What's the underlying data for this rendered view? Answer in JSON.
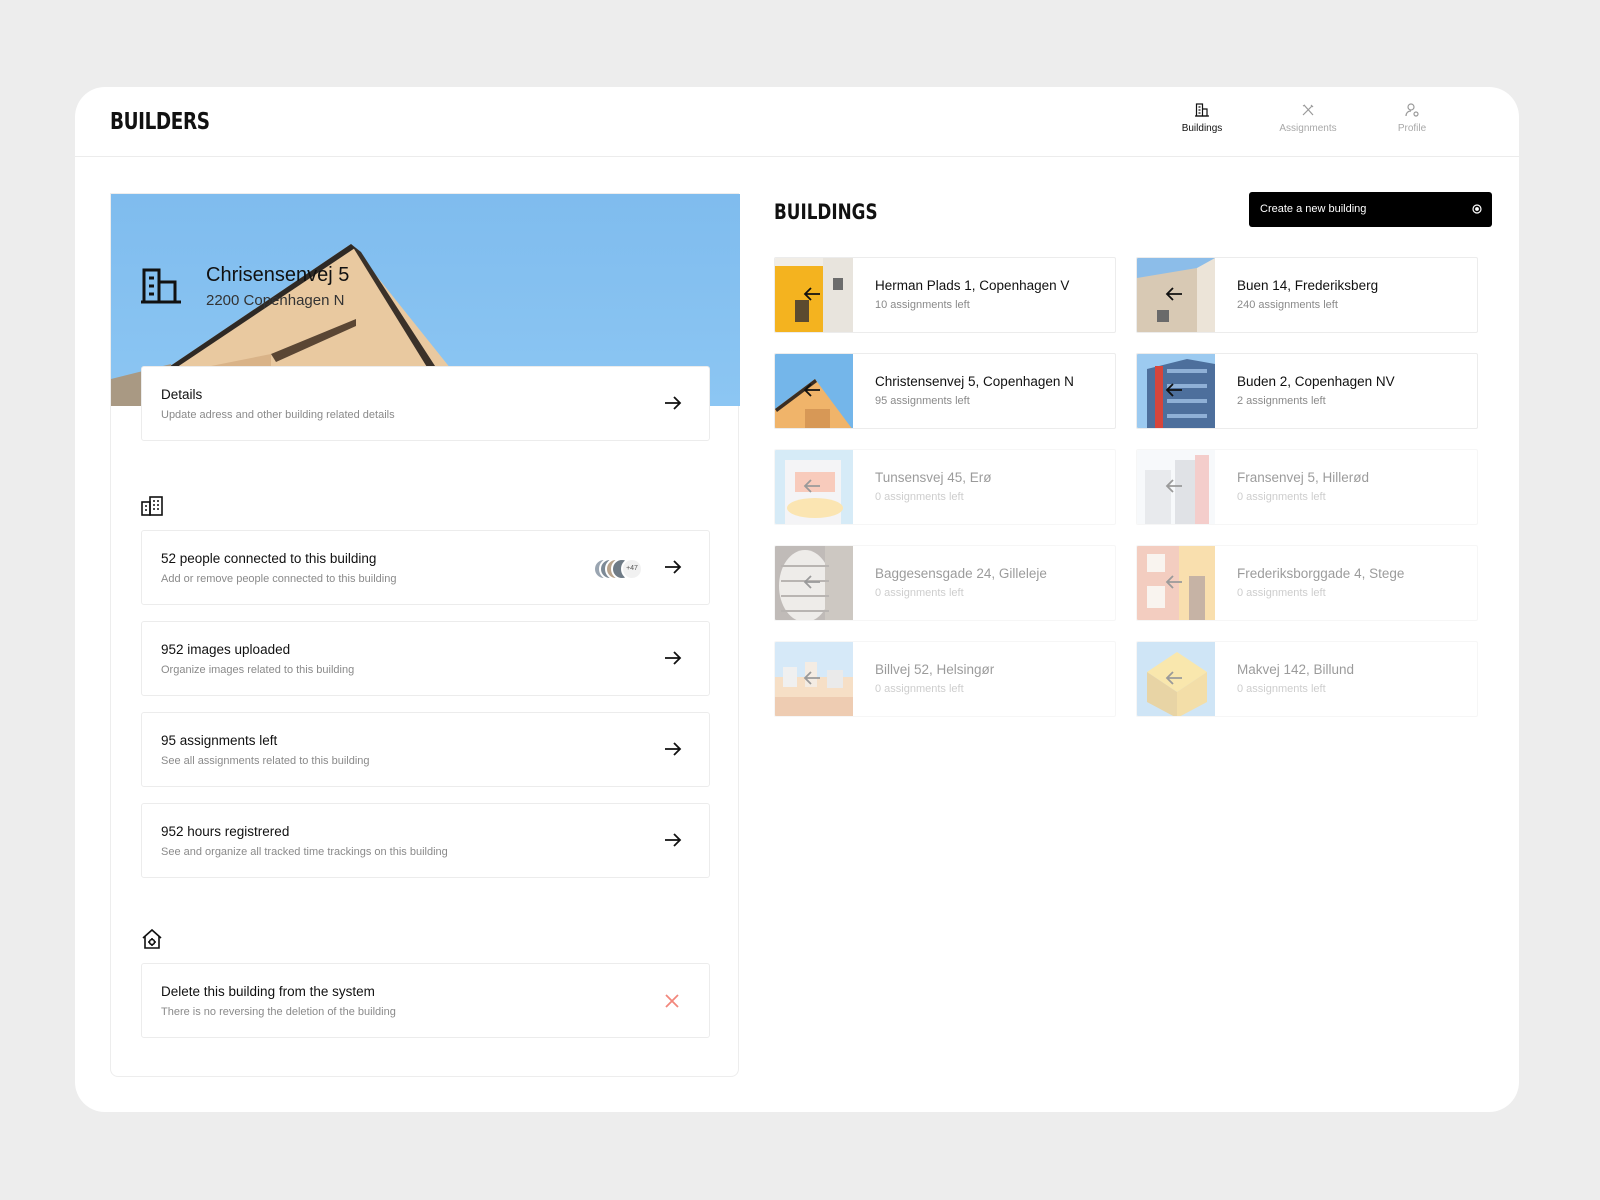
{
  "app": {
    "logo": "BUILDERS"
  },
  "nav": [
    {
      "label": "Buildings",
      "icon": "building-icon",
      "active": true
    },
    {
      "label": "Assignments",
      "icon": "tools-icon",
      "active": false
    },
    {
      "label": "Profile",
      "icon": "profile-icon",
      "active": false
    }
  ],
  "detail": {
    "title": "Chrisensenvej 5",
    "subtitle": "2200 Copenhagen N",
    "details_card": {
      "title": "Details",
      "subtitle": "Update adress and other building related details"
    },
    "people_card": {
      "title": "52 people connected to this building",
      "subtitle": "Add or remove people connected to this building",
      "more_count": "+47"
    },
    "images_card": {
      "title": "952 images uploaded",
      "subtitle": "Organize images related to this building"
    },
    "assignments_card": {
      "title": "95 assignments left",
      "subtitle": "See all assignments related to this building"
    },
    "hours_card": {
      "title": "952 hours registrered",
      "subtitle": "See and organize all tracked time trackings on this building"
    },
    "delete_card": {
      "title": "Delete this building from the system",
      "subtitle": "There is no reversing the deletion of the building"
    }
  },
  "buildings": {
    "title": "BUILDINGS",
    "create_label": "Create a new building",
    "items": [
      {
        "name": "Herman Plads 1, Copenhagen V",
        "assignments": "10 assignments left",
        "faded": false,
        "thumb": "yellow-building"
      },
      {
        "name": "Buen 14, Frederiksberg",
        "assignments": "240 assignments left",
        "faded": false,
        "thumb": "beige-wall"
      },
      {
        "name": "Christensenvej 5, Copenhagen N",
        "assignments": "95 assignments left",
        "faded": false,
        "thumb": "orange-corner"
      },
      {
        "name": "Buden 2,  Copenhagen NV",
        "assignments": "2 assignments left",
        "faded": false,
        "thumb": "blue-tower"
      },
      {
        "name": "Tunsensvej 45, Erø",
        "assignments": "0 assignments left",
        "faded": true,
        "thumb": "pink-balcony"
      },
      {
        "name": "Fransenvej 5, Hillerød",
        "assignments": "0 assignments left",
        "faded": true,
        "thumb": "white-highrise"
      },
      {
        "name": "Baggesensgade 24, Gilleleje",
        "assignments": "0 assignments left",
        "faded": true,
        "thumb": "round-tower"
      },
      {
        "name": "Frederiksborggade 4, Stege",
        "assignments": "0 assignments left",
        "faded": true,
        "thumb": "pink-house"
      },
      {
        "name": "Billvej 52, Helsingør",
        "assignments": "0 assignments left",
        "faded": true,
        "thumb": "city-view"
      },
      {
        "name": "Makvej 142, Billund",
        "assignments": "0 assignments left",
        "faded": true,
        "thumb": "cube-houses"
      }
    ]
  },
  "colors": {
    "accent": "#000000",
    "danger": "#f2877c",
    "sky": "#86c1f1"
  }
}
